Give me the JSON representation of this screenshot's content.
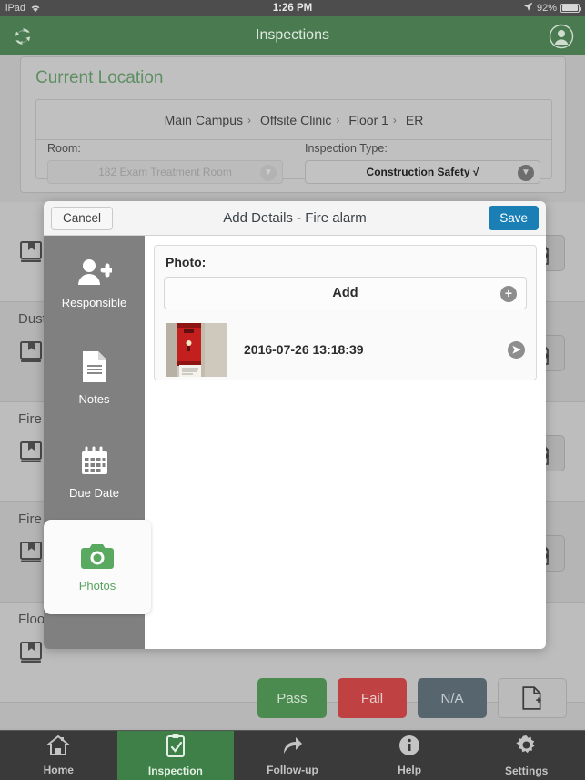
{
  "status_bar": {
    "device": "iPad",
    "wifi_icon": "wifi-icon",
    "time": "1:26 PM",
    "location_icon": "location-arrow-icon",
    "battery": "92%",
    "battery_icon": "battery-icon"
  },
  "navbar": {
    "title": "Inspections",
    "refresh_icon": "refresh-icon",
    "account_icon": "account-avatar-icon",
    "background_color": "#4a7a50"
  },
  "location_card": {
    "title": "Current Location",
    "breadcrumb": [
      {
        "label": "Main Campus",
        "separator": "›"
      },
      {
        "label": "Offsite Clinic",
        "separator": "›"
      },
      {
        "label": "Floor 1",
        "separator": "›"
      },
      {
        "label": "ER",
        "separator": ""
      }
    ],
    "room": {
      "label": "Room:",
      "value": "182 Exam Treatment Room",
      "disabled": true
    },
    "inspection_type": {
      "label": "Inspection Type:",
      "value": "Construction Safety √",
      "disabled": false
    }
  },
  "inspection_rows": [
    {
      "label": "",
      "book_icon": "book-icon",
      "note_icon": "add-note-icon"
    },
    {
      "label": "Dust",
      "book_icon": "book-icon",
      "note_icon": "add-note-icon"
    },
    {
      "label": "Fire",
      "book_icon": "book-icon",
      "note_icon": "add-note-icon"
    },
    {
      "label": "Fire",
      "book_icon": "book-icon",
      "note_icon": "add-note-icon"
    },
    {
      "label": "Floor mats",
      "book_icon": "book-icon",
      "note_icon": "add-note-icon"
    }
  ],
  "actions": {
    "pass": "Pass",
    "fail": "Fail",
    "na": "N/A",
    "doc_icon": "add-document-icon",
    "pass_color": "#4b8b4f",
    "fail_color": "#bf4141",
    "na_color": "#57666e"
  },
  "modal": {
    "cancel_label": "Cancel",
    "title": "Add Details - Fire alarm",
    "save_label": "Save",
    "save_color": "#1a7fb5",
    "sidebar": [
      {
        "label": "Responsible",
        "icon": "add-person-icon",
        "active": false
      },
      {
        "label": "Notes",
        "icon": "document-lines-icon",
        "active": false
      },
      {
        "label": "Due Date",
        "icon": "calendar-icon",
        "active": false
      },
      {
        "label": "Photos",
        "icon": "camera-icon",
        "active": true
      }
    ],
    "photo_panel": {
      "heading": "Photo:",
      "add_label": "Add",
      "add_icon": "plus-circle-icon",
      "items": [
        {
          "timestamp": "2016-07-26 13:18:39",
          "thumbnail_alt": "red-fire-alarm-pull-station-photo",
          "chevron_icon": "chevron-right-icon"
        }
      ]
    }
  },
  "tabbar": [
    {
      "label": "Home",
      "icon": "home-icon",
      "active": false
    },
    {
      "label": "Inspection",
      "icon": "clipboard-check-icon",
      "active": true
    },
    {
      "label": "Follow-up",
      "icon": "arrow-forward-icon",
      "active": false
    },
    {
      "label": "Help",
      "icon": "info-icon",
      "active": false
    },
    {
      "label": "Settings",
      "icon": "gear-icon",
      "active": false
    }
  ]
}
